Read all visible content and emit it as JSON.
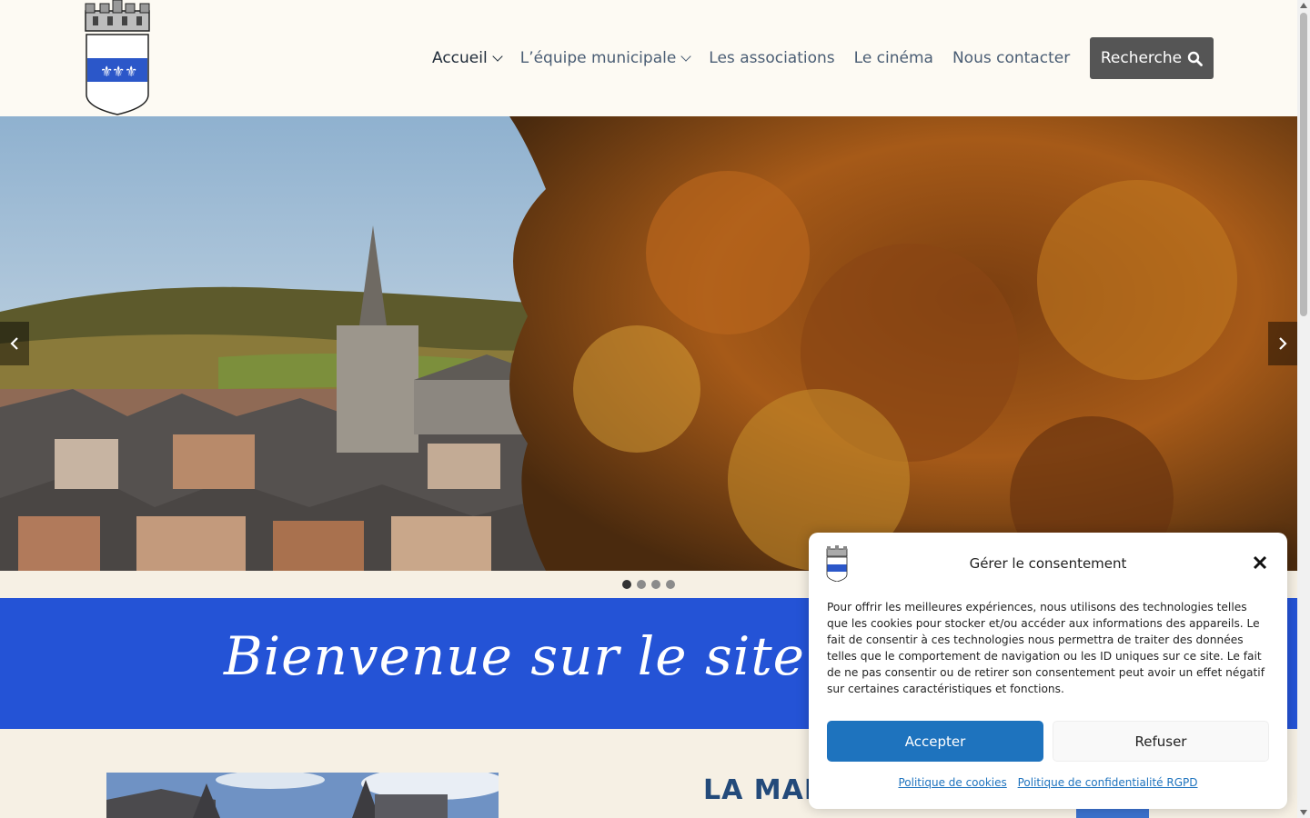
{
  "nav": {
    "items": [
      {
        "label": "Accueil",
        "has_dropdown": true,
        "active": true
      },
      {
        "label": "L’équipe municipale",
        "has_dropdown": true,
        "active": false
      },
      {
        "label": "Les associations",
        "has_dropdown": false,
        "active": false
      },
      {
        "label": "Le cinéma",
        "has_dropdown": false,
        "active": false
      },
      {
        "label": "Nous contacter",
        "has_dropdown": false,
        "active": false
      }
    ],
    "search_label": "Recherche",
    "search_icon": "search-icon"
  },
  "slider": {
    "slide_count": 4,
    "active_index": 0
  },
  "welcome": {
    "text": "Bienvenue sur le site de la Vi"
  },
  "section": {
    "title": "LA MAI"
  },
  "consent": {
    "title": "Gérer le consentement",
    "body": "Pour offrir les meilleures expériences, nous utilisons des technologies telles que les cookies pour stocker et/ou accéder aux informations des appareils. Le fait de consentir à ces technologies nous permettra de traiter des données telles que le comportement de navigation ou les ID uniques sur ce site. Le fait de ne pas consentir ou de retirer son consentement peut avoir un effet négatif sur certaines caractéristiques et fonctions.",
    "accept_label": "Accepter",
    "refuse_label": "Refuser",
    "links": [
      "Politique de cookies",
      "Politique de confidentialité RGPD"
    ]
  },
  "colors": {
    "welcome_band": "#2453d6",
    "accept_button": "#1e73be",
    "search_button": "#555555",
    "section_title": "#234a7a"
  }
}
